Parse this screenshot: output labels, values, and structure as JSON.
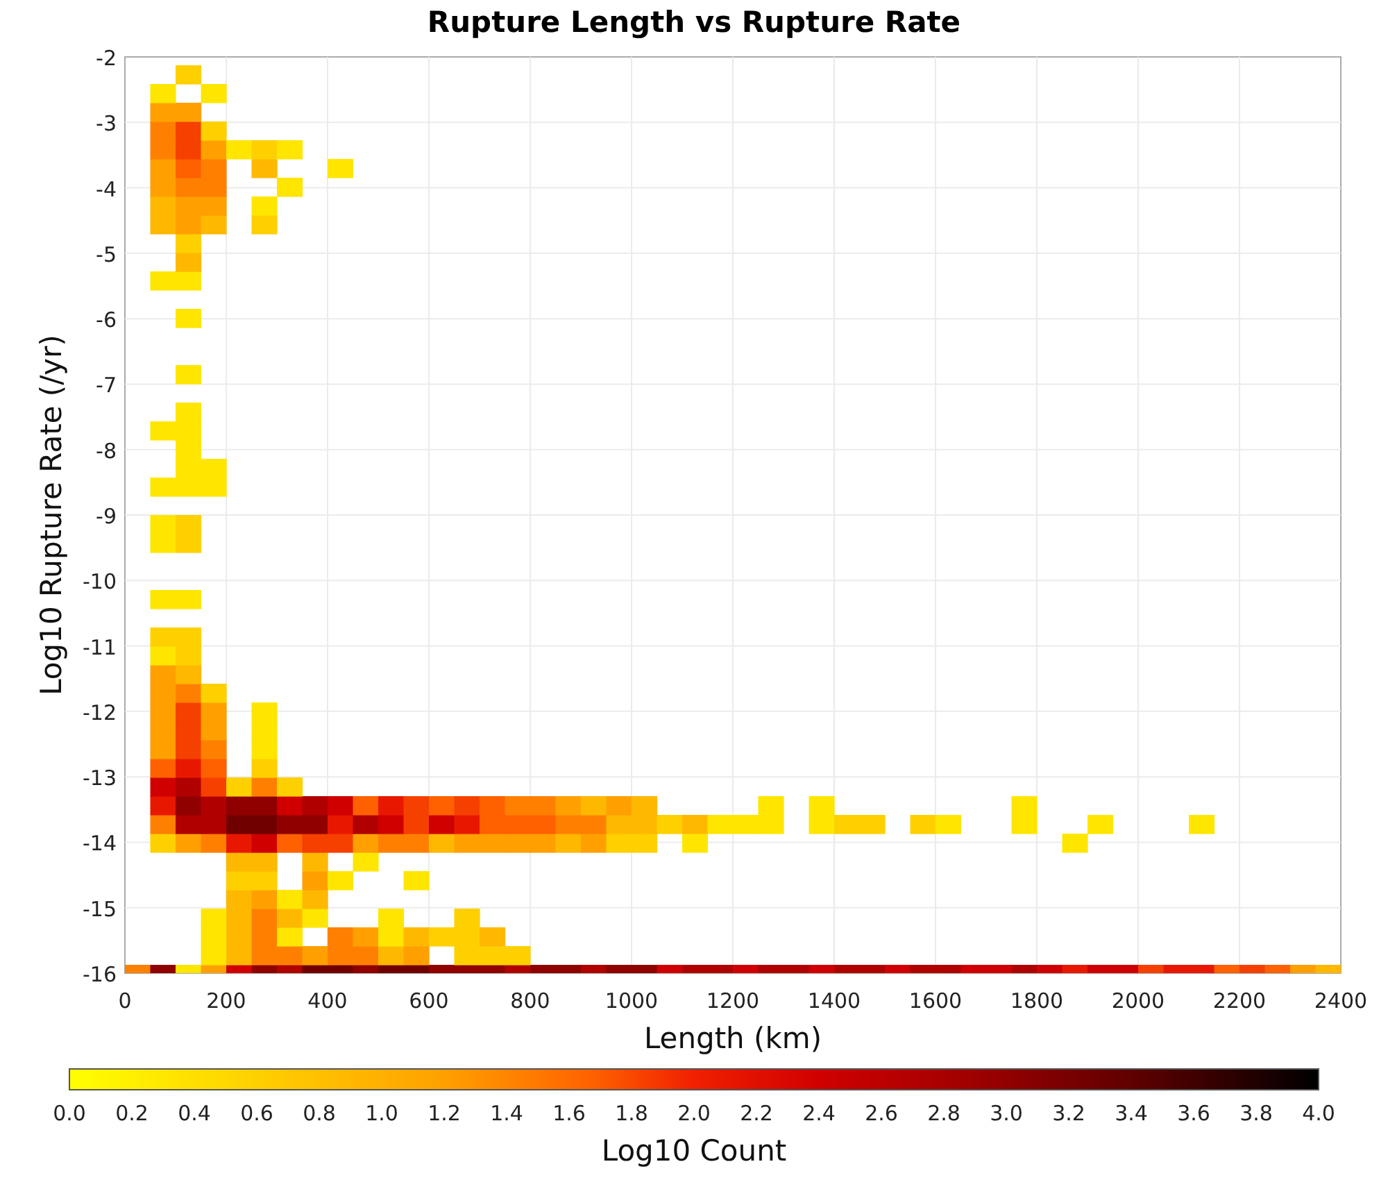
{
  "chart": {
    "title": "Rupture Length vs Rupture Rate",
    "xlabel": "Length (km)",
    "ylabel": "Log10 Rupture Rate (/yr)",
    "xticks": [
      "0",
      "200",
      "400",
      "600",
      "800",
      "1000",
      "1200",
      "1400",
      "1600",
      "1800",
      "2000",
      "2200",
      "2400"
    ],
    "yticks": [
      "-2",
      "-3",
      "-4",
      "-5",
      "-6",
      "-7",
      "-8",
      "-9",
      "-10",
      "-11",
      "-12",
      "-13",
      "-14",
      "-15",
      "-16"
    ]
  },
  "colorbar": {
    "label": "Log10 Count",
    "ticks": [
      "0.0",
      "0.2",
      "0.4",
      "0.6",
      "0.8",
      "1.0",
      "1.2",
      "1.4",
      "1.6",
      "1.8",
      "2.0",
      "2.2",
      "2.4",
      "2.6",
      "2.8",
      "3.0",
      "3.2",
      "3.4",
      "3.6",
      "3.8",
      "4.0"
    ]
  }
}
